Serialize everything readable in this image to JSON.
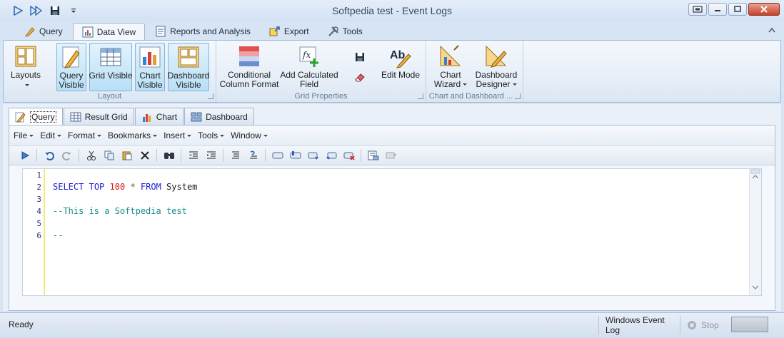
{
  "window": {
    "title": "Softpedia test - Event Logs"
  },
  "ribbon_tabs": [
    {
      "label": "Query",
      "icon": "query-icon"
    },
    {
      "label": "Data View",
      "icon": "data-view-icon",
      "active": true
    },
    {
      "label": "Reports and Analysis",
      "icon": "reports-icon"
    },
    {
      "label": "Export",
      "icon": "export-icon"
    },
    {
      "label": "Tools",
      "icon": "tools-icon"
    }
  ],
  "ribbon": {
    "groups": {
      "layout": {
        "label": "Layout",
        "buttons": {
          "layouts": {
            "line1": "Layouts"
          },
          "query_visible": {
            "line1": "Query",
            "line2": "Visible"
          },
          "grid_visible": {
            "line1": "Grid Visible"
          },
          "chart_visible": {
            "line1": "Chart",
            "line2": "Visible"
          },
          "dashboard_visible": {
            "line1": "Dashboard",
            "line2": "Visible"
          }
        }
      },
      "grid_properties": {
        "label": "Grid Properties",
        "buttons": {
          "conditional_format": {
            "line1": "Conditional",
            "line2": "Column Format"
          },
          "add_calculated": {
            "line1": "Add Calculated",
            "line2": "Field"
          },
          "edit_mode": {
            "line1": "Edit Mode"
          }
        }
      },
      "chart_dashboard": {
        "label": "Chart and Dashboard ...",
        "buttons": {
          "chart_wizard": {
            "line1": "Chart",
            "line2": "Wizard"
          },
          "dashboard_designer": {
            "line1": "Dashboard",
            "line2": "Designer"
          }
        }
      }
    }
  },
  "doc_tabs": [
    {
      "label": "Query",
      "icon": "pencil-icon",
      "active": true
    },
    {
      "label": "Result Grid",
      "icon": "grid-icon"
    },
    {
      "label": "Chart",
      "icon": "bar-chart-icon"
    },
    {
      "label": "Dashboard",
      "icon": "dashboard-icon"
    }
  ],
  "menu": [
    "File",
    "Edit",
    "Format",
    "Bookmarks",
    "Insert",
    "Tools",
    "Window"
  ],
  "editor": {
    "line_numbers": [
      "1",
      "2",
      "3",
      "4",
      "5",
      "6"
    ],
    "line2": {
      "kw1": "SELECT",
      "kw2": "TOP",
      "num": "100",
      "op": "*",
      "kw3": "FROM",
      "id": "System"
    },
    "line4": "--This is a Softpedia test",
    "line6": "--"
  },
  "status": {
    "ready": "Ready",
    "source": "Windows Event Log",
    "stop": "Stop"
  },
  "colors": {
    "accent": "#b9dff6",
    "keyword": "#1a1ad6",
    "number": "#d61a1a",
    "comment": "#1a8a8a"
  }
}
